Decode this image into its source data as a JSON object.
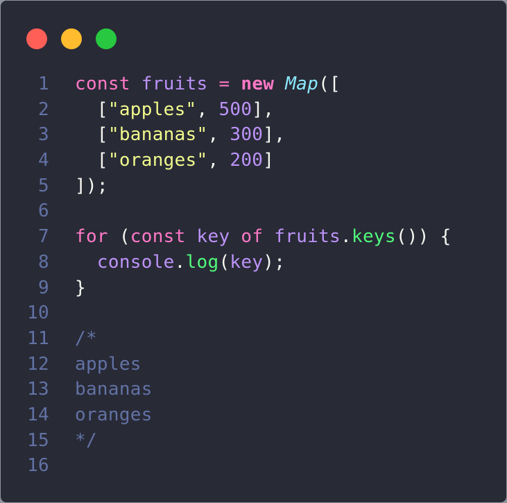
{
  "window": {
    "controls": [
      {
        "name": "close",
        "color": "#ff5f57"
      },
      {
        "name": "minimize",
        "color": "#febc2e"
      },
      {
        "name": "maximize",
        "color": "#28c840"
      }
    ]
  },
  "code": {
    "lines": [
      {
        "n": "1",
        "tokens": [
          {
            "t": "const",
            "c": "kw"
          },
          {
            "t": " ",
            "c": "punc"
          },
          {
            "t": "fruits",
            "c": "ident"
          },
          {
            "t": " = ",
            "c": "kw"
          },
          {
            "t": "new",
            "c": "kwb"
          },
          {
            "t": " ",
            "c": "punc"
          },
          {
            "t": "Map",
            "c": "cls"
          },
          {
            "t": "([",
            "c": "punc"
          }
        ]
      },
      {
        "n": "2",
        "tokens": [
          {
            "t": "  [",
            "c": "punc"
          },
          {
            "t": "\"apples\"",
            "c": "str"
          },
          {
            "t": ", ",
            "c": "punc"
          },
          {
            "t": "500",
            "c": "num"
          },
          {
            "t": "],",
            "c": "punc"
          }
        ]
      },
      {
        "n": "3",
        "tokens": [
          {
            "t": "  [",
            "c": "punc"
          },
          {
            "t": "\"bananas\"",
            "c": "str"
          },
          {
            "t": ", ",
            "c": "punc"
          },
          {
            "t": "300",
            "c": "num"
          },
          {
            "t": "],",
            "c": "punc"
          }
        ]
      },
      {
        "n": "4",
        "tokens": [
          {
            "t": "  [",
            "c": "punc"
          },
          {
            "t": "\"oranges\"",
            "c": "str"
          },
          {
            "t": ", ",
            "c": "punc"
          },
          {
            "t": "200",
            "c": "num"
          },
          {
            "t": "]",
            "c": "punc"
          }
        ]
      },
      {
        "n": "5",
        "tokens": [
          {
            "t": "]);",
            "c": "punc"
          }
        ]
      },
      {
        "n": "6",
        "tokens": []
      },
      {
        "n": "7",
        "tokens": [
          {
            "t": "for",
            "c": "kw"
          },
          {
            "t": " (",
            "c": "punc"
          },
          {
            "t": "const",
            "c": "kw"
          },
          {
            "t": " ",
            "c": "punc"
          },
          {
            "t": "key",
            "c": "ident"
          },
          {
            "t": " ",
            "c": "punc"
          },
          {
            "t": "of",
            "c": "kw"
          },
          {
            "t": " ",
            "c": "punc"
          },
          {
            "t": "fruits",
            "c": "ident"
          },
          {
            "t": ".",
            "c": "punc"
          },
          {
            "t": "keys",
            "c": "fn"
          },
          {
            "t": "()) {",
            "c": "punc"
          }
        ]
      },
      {
        "n": "8",
        "tokens": [
          {
            "t": "  ",
            "c": "punc"
          },
          {
            "t": "console",
            "c": "ident"
          },
          {
            "t": ".",
            "c": "punc"
          },
          {
            "t": "log",
            "c": "fn"
          },
          {
            "t": "(",
            "c": "punc"
          },
          {
            "t": "key",
            "c": "ident"
          },
          {
            "t": ");",
            "c": "punc"
          }
        ]
      },
      {
        "n": "9",
        "tokens": [
          {
            "t": "}",
            "c": "punc"
          }
        ]
      },
      {
        "n": "10",
        "tokens": []
      },
      {
        "n": "11",
        "tokens": [
          {
            "t": "/*",
            "c": "cmt"
          }
        ]
      },
      {
        "n": "12",
        "tokens": [
          {
            "t": "apples",
            "c": "cmt"
          }
        ]
      },
      {
        "n": "13",
        "tokens": [
          {
            "t": "bananas",
            "c": "cmt"
          }
        ]
      },
      {
        "n": "14",
        "tokens": [
          {
            "t": "oranges",
            "c": "cmt"
          }
        ]
      },
      {
        "n": "15",
        "tokens": [
          {
            "t": "*/",
            "c": "cmt"
          }
        ]
      },
      {
        "n": "16",
        "tokens": []
      }
    ]
  }
}
